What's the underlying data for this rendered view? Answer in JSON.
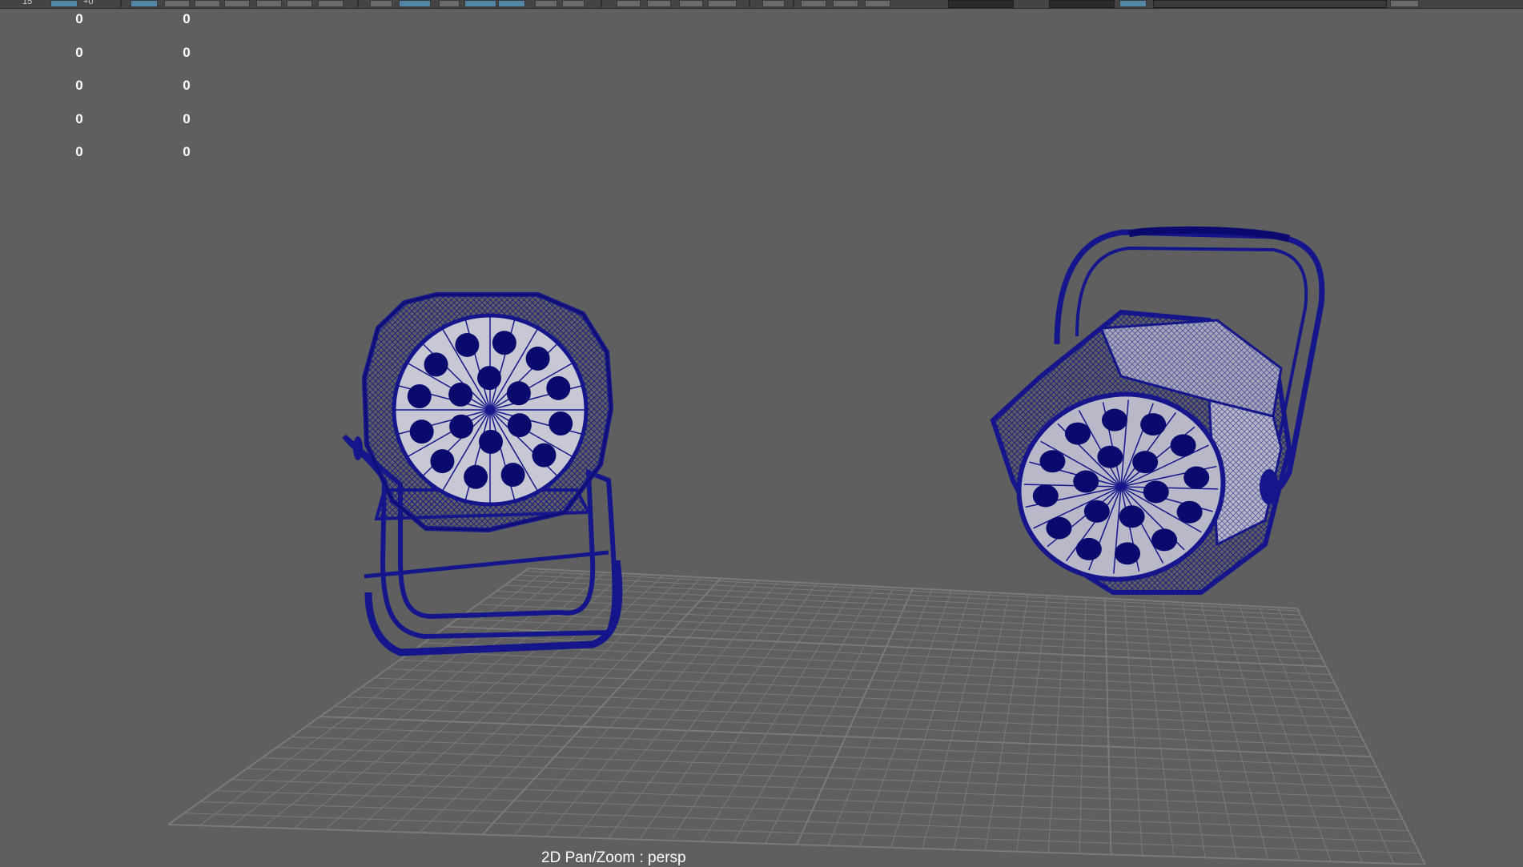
{
  "toolbar": {
    "frame_start": "15",
    "frame_end": "+0",
    "icons": [
      "select-tool-icon",
      "lasso-tool-icon",
      "paint-select-icon",
      "move-tool-icon",
      "rotate-tool-icon",
      "scale-tool-icon",
      "snap-grid-icon",
      "snap-curve-icon",
      "snap-point-icon",
      "snap-plane-icon",
      "make-live-icon",
      "history-icon",
      "render-icon",
      "ipr-render-icon",
      "render-settings-icon",
      "hypershade-icon",
      "attribute-editor-icon",
      "channel-box-icon",
      "tool-settings-icon",
      "modeling-toolkit-icon",
      "xray-icon",
      "isolate-select-icon"
    ]
  },
  "hud": {
    "rows": [
      {
        "col1": "0",
        "col2": "0"
      },
      {
        "col1": "0",
        "col2": "0"
      },
      {
        "col1": "0",
        "col2": "0"
      },
      {
        "col1": "0",
        "col2": "0"
      },
      {
        "col1": "0",
        "col2": "0"
      }
    ]
  },
  "viewport": {
    "camera_label": "2D Pan/Zoom : persp"
  },
  "colors": {
    "background": "#5f5f5f",
    "grid": "#7a7a7a",
    "wireframe": "#16168c",
    "lens": "#c8c8d4",
    "led": "#0a0a6e"
  }
}
